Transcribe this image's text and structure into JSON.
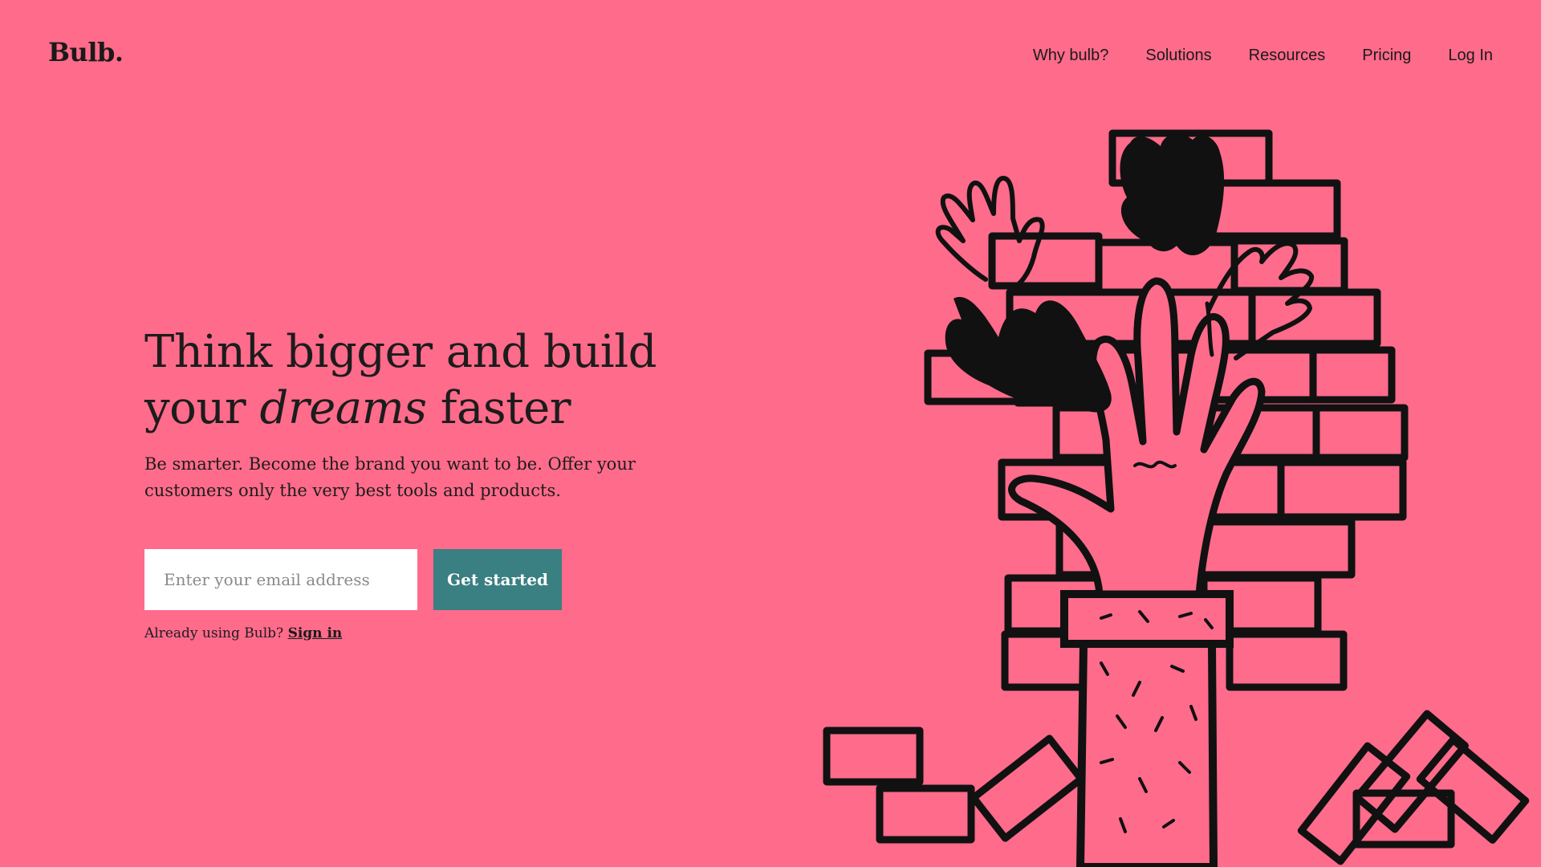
{
  "header": {
    "logo": "Bulb.",
    "nav": [
      {
        "label": "Why bulb?"
      },
      {
        "label": "Solutions"
      },
      {
        "label": "Resources"
      },
      {
        "label": "Pricing"
      },
      {
        "label": "Log In"
      }
    ]
  },
  "hero": {
    "headline_part1": "Think bigger and build your ",
    "headline_emphasis": "dreams",
    "headline_part2": " faster",
    "subheadline": "Be smarter. Become the brand you want to be. Offer your customers only the very best tools and products."
  },
  "signup": {
    "email_placeholder": "Enter your email address",
    "email_value": "",
    "button_label": "Get started",
    "signin_prompt": "Already using Bulb?",
    "signin_link": "Sign in"
  },
  "illustration": {
    "icon": "hands-through-brick-wall-illustration"
  },
  "colors": {
    "background": "#FF6B8B",
    "accent": "#3A7F82",
    "text": "#1c1c1c",
    "input_background": "#FFFFFF"
  }
}
